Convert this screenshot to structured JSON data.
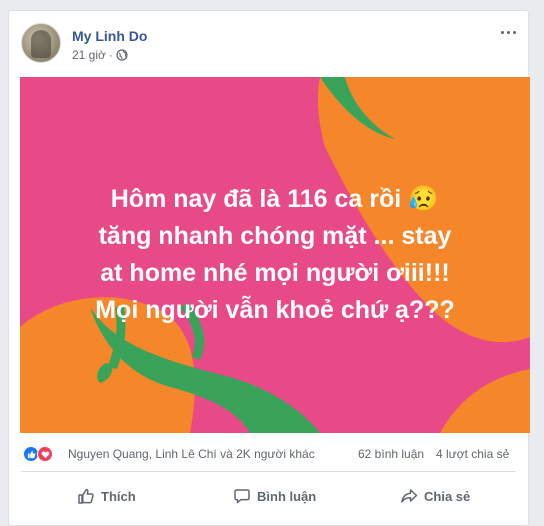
{
  "post": {
    "author": "My Linh Do",
    "time": "21 giờ",
    "privacy_icon": "globe-icon",
    "text_lines": [
      "Hôm nay đã là 116 ca rồi 😥",
      "tăng nhanh chóng mặt ... stay",
      "at home nhé mọi người ơiii!!!",
      "Mọi người vẫn khoẻ chứ ạ???"
    ],
    "background_colors": {
      "pink": "#e84a88",
      "orange": "#f5872a",
      "green": "#3aa35a"
    }
  },
  "stats": {
    "reaction_icons": [
      "like-icon",
      "love-icon"
    ],
    "reaction_names": "Nguyen Quang, Linh Lê Chí và 2K người khác",
    "comments": "62 bình luận",
    "shares": "4 lượt chia sẻ"
  },
  "actions": {
    "like": "Thích",
    "comment": "Bình luận",
    "share": "Chia sẻ"
  }
}
